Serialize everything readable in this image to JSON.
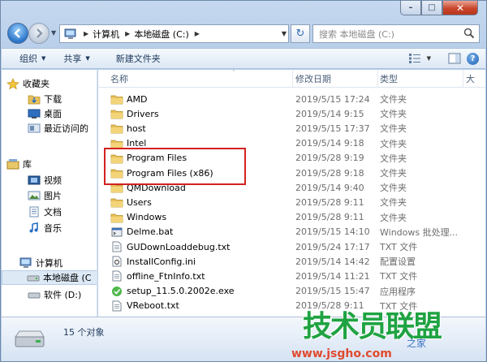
{
  "window": {
    "caption_buttons": [
      "minimize",
      "maximize",
      "close"
    ]
  },
  "address": {
    "crumbs": [
      "计算机",
      "本地磁盘 (C:)"
    ],
    "search_placeholder": "搜索 本地磁盘 (C:)"
  },
  "toolbar": {
    "organize": "组织",
    "share": "共享",
    "new_folder": "新建文件夹"
  },
  "nav": {
    "favorites": "收藏夹",
    "downloads": "下载",
    "desktop": "桌面",
    "recent": "最近访问的",
    "libraries": "库",
    "videos": "视频",
    "pictures": "图片",
    "documents": "文档",
    "music": "音乐",
    "computer": "计算机",
    "local_disk": "本地磁盘 (C",
    "software": "软件 (D:)"
  },
  "columns": {
    "name": "名称",
    "date": "修改日期",
    "type": "类型",
    "size": "大"
  },
  "files": [
    {
      "name": "AMD",
      "date": "2019/5/15 17:24",
      "type": "文件夹",
      "icon": "folder-icon"
    },
    {
      "name": "Drivers",
      "date": "2019/5/14 9:15",
      "type": "文件夹",
      "icon": "folder-icon"
    },
    {
      "name": "host",
      "date": "2019/5/15 17:37",
      "type": "文件夹",
      "icon": "folder-icon"
    },
    {
      "name": "Intel",
      "date": "2019/5/14 9:18",
      "type": "文件夹",
      "icon": "folder-icon"
    },
    {
      "name": "Program Files",
      "date": "2019/5/28 9:19",
      "type": "文件夹",
      "icon": "folder-icon"
    },
    {
      "name": "Program Files (x86)",
      "date": "2019/5/28 9:18",
      "type": "文件夹",
      "icon": "folder-icon"
    },
    {
      "name": "QMDownload",
      "date": "2019/5/14 9:40",
      "type": "文件夹",
      "icon": "folder-icon"
    },
    {
      "name": "Users",
      "date": "2019/5/28 9:11",
      "type": "文件夹",
      "icon": "folder-icon"
    },
    {
      "name": "Windows",
      "date": "2019/5/28 9:11",
      "type": "文件夹",
      "icon": "folder-icon"
    },
    {
      "name": "Delme.bat",
      "date": "2019/5/15 14:10",
      "type": "Windows 批处理...",
      "icon": "batch-file-icon"
    },
    {
      "name": "GUDownLoaddebug.txt",
      "date": "2019/5/24 17:17",
      "type": "TXT 文件",
      "icon": "text-file-icon"
    },
    {
      "name": "InstallConfig.ini",
      "date": "2019/5/14 14:42",
      "type": "配置设置",
      "icon": "config-file-icon"
    },
    {
      "name": "offline_FtnInfo.txt",
      "date": "2019/5/14 11:21",
      "type": "TXT 文件",
      "icon": "text-file-icon"
    },
    {
      "name": "setup_11.5.0.2002e.exe",
      "date": "2019/5/15 15:47",
      "type": "应用程序",
      "icon": "exe-file-icon"
    },
    {
      "name": "VReboot.txt",
      "date": "2019/5/28 9:11",
      "type": "TXT 文件",
      "icon": "text-file-icon"
    }
  ],
  "status": {
    "count": "15 个对象"
  },
  "watermark": {
    "title": "技术员联盟",
    "small": "之家",
    "url": "www.jsgho.com"
  },
  "colors": {
    "highlight": "#d42020",
    "folder": "#e8c15a",
    "watermark_green": "#1fa342"
  }
}
